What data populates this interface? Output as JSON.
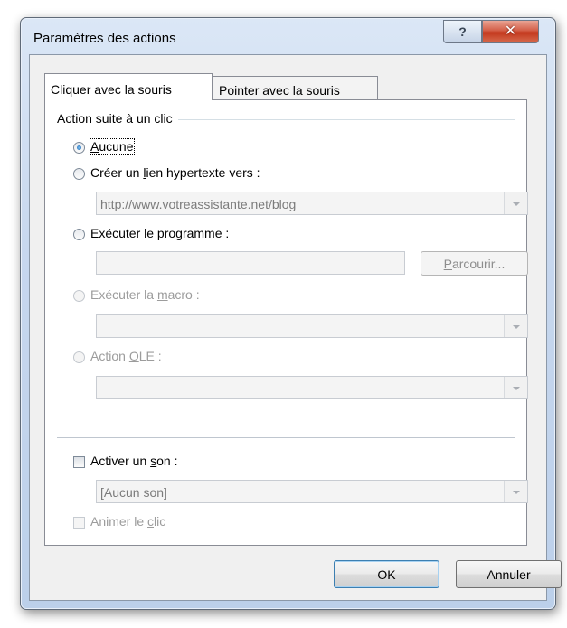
{
  "window": {
    "title": "Paramètres des actions",
    "help_glyph": "?",
    "close_glyph": "✕"
  },
  "tabs": [
    {
      "label": "Cliquer avec la souris",
      "selected": true
    },
    {
      "label": "Pointer avec la souris",
      "selected": false
    }
  ],
  "group": {
    "label": "Action suite à un clic"
  },
  "options": {
    "none": {
      "pre": "",
      "ul": "A",
      "post": "ucune",
      "checked": true
    },
    "hyperlink": {
      "pre": "Créer un ",
      "ul": "l",
      "post": "ien hypertexte vers :",
      "checked": false
    },
    "run_program": {
      "pre": "",
      "ul": "E",
      "post": "xécuter le programme :",
      "checked": false
    },
    "run_macro": {
      "pre": "Exécuter la ",
      "ul": "m",
      "post": "acro :",
      "checked": false,
      "enabled": false
    },
    "ole_action": {
      "pre": "Action ",
      "ul": "O",
      "post": "LE :",
      "checked": false,
      "enabled": false
    }
  },
  "hyperlink_value": "http://www.votreassistante.net/blog",
  "program_value": "",
  "browse_button": {
    "ul": "P",
    "post": "arcourir..."
  },
  "macro_value": "",
  "ole_value": "",
  "sound": {
    "checkbox": {
      "pre": "Activer un ",
      "ul": "s",
      "post": "on :",
      "checked": false
    },
    "value": "[Aucun son]"
  },
  "animate": {
    "pre": "Animer le ",
    "ul": "c",
    "post": "lic",
    "checked": false,
    "enabled": false
  },
  "buttons": {
    "ok": "OK",
    "cancel": "Annuler"
  },
  "colors": {
    "accent": "#3c7fb1",
    "close": "#c3381d",
    "disabled_text": "#9c9c9c"
  }
}
